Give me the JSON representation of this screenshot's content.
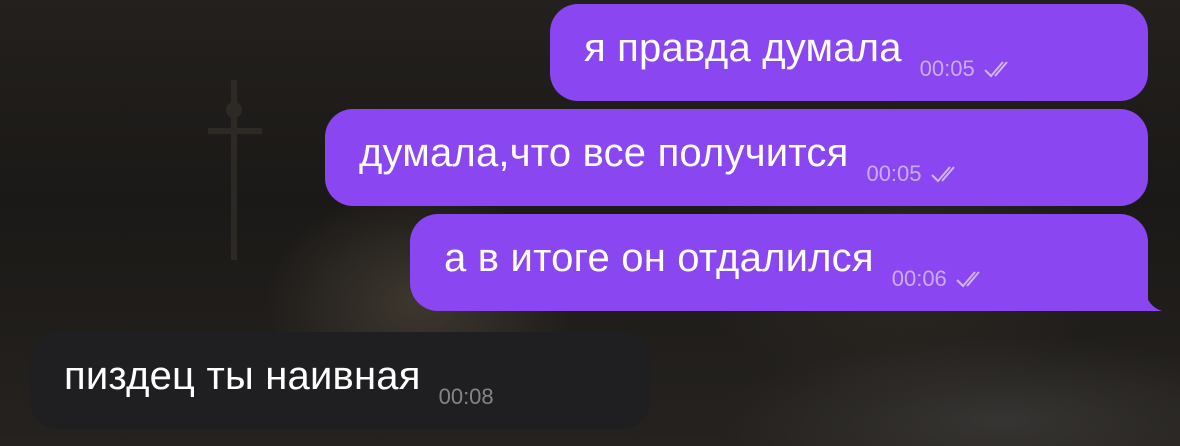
{
  "chat": {
    "messages": [
      {
        "direction": "outgoing",
        "text": "я правда думала",
        "time": "00:05",
        "status": "read-double-check-icon"
      },
      {
        "direction": "outgoing",
        "text": "думала,что все получится",
        "time": "00:05",
        "status": "read-double-check-icon"
      },
      {
        "direction": "outgoing",
        "text": "а в итоге он отдалился",
        "time": "00:06",
        "status": "read-double-check-icon"
      },
      {
        "direction": "incoming",
        "text": "пиздец ты наивная",
        "time": "00:08"
      }
    ]
  },
  "colors": {
    "outgoing_bubble": "#8a46f0",
    "incoming_bubble": "#1f1f21",
    "text": "#ffffff"
  }
}
